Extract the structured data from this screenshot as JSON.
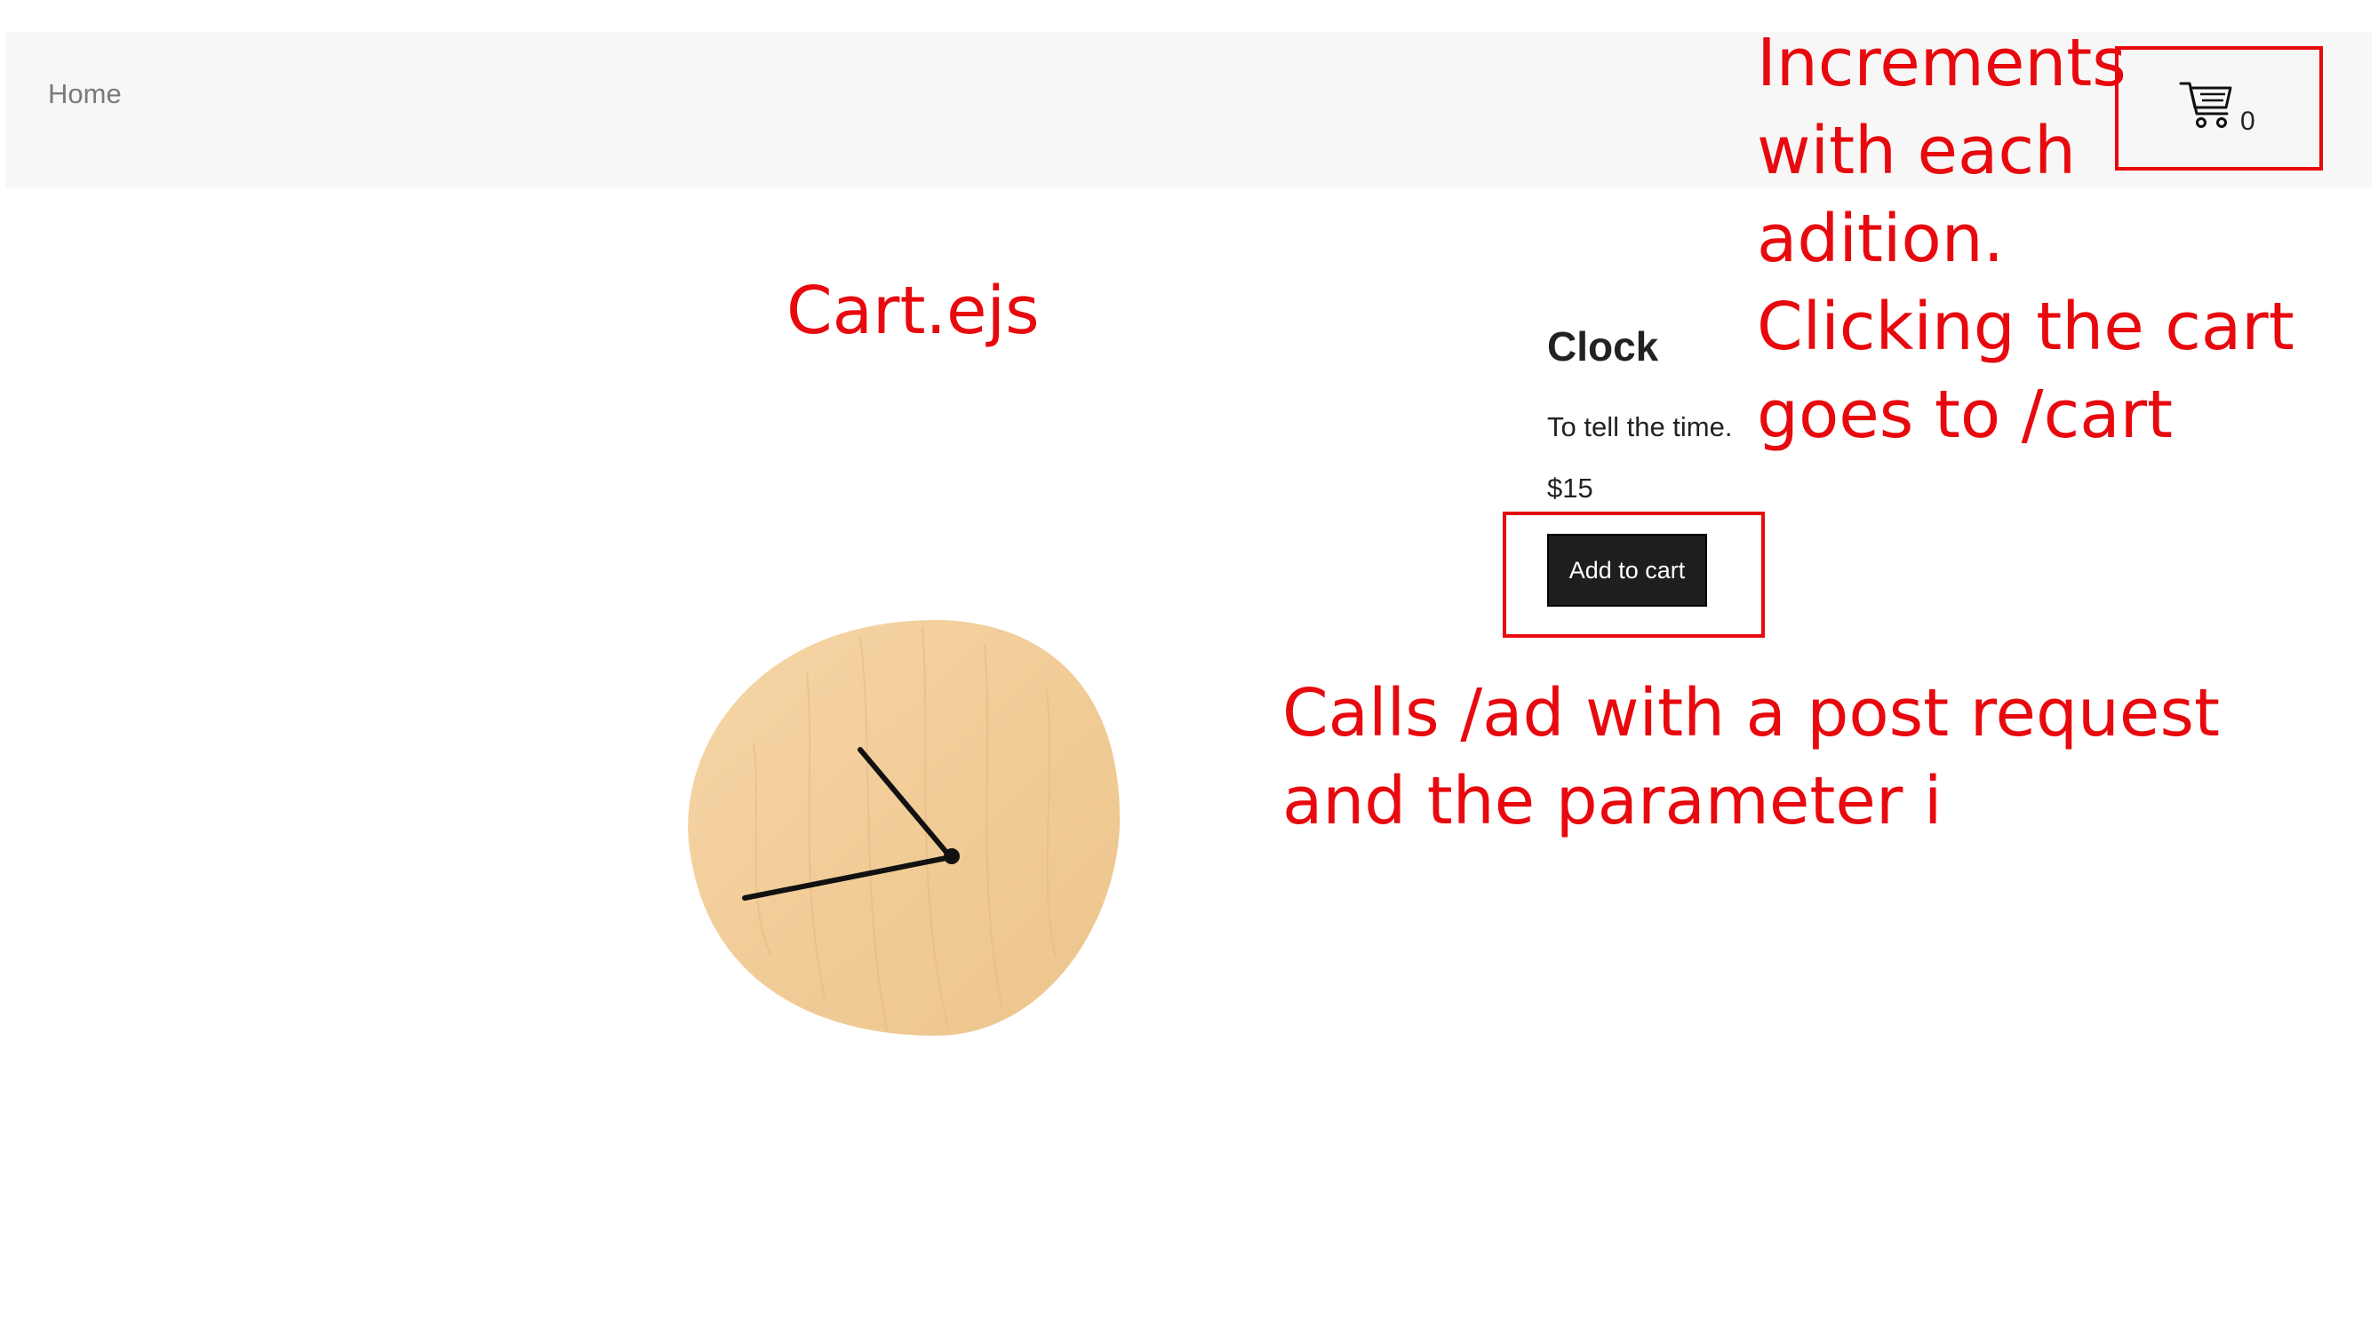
{
  "nav": {
    "home_label": "Home",
    "cart_icon": "shopping-cart-icon",
    "cart_count": "0"
  },
  "product": {
    "title": "Clock",
    "description": "To tell the time.",
    "price": "$15",
    "add_button_label": "Add to cart",
    "image_alt": "wooden-wall-clock-image"
  },
  "annotations": {
    "file_label": "Cart.ejs",
    "cart_note": "Increments\nwith each\nadition.\nClicking the cart\ngoes to /cart",
    "button_note": "Calls /ad with a post request\nand the parameter i",
    "color": "#e8090e"
  }
}
